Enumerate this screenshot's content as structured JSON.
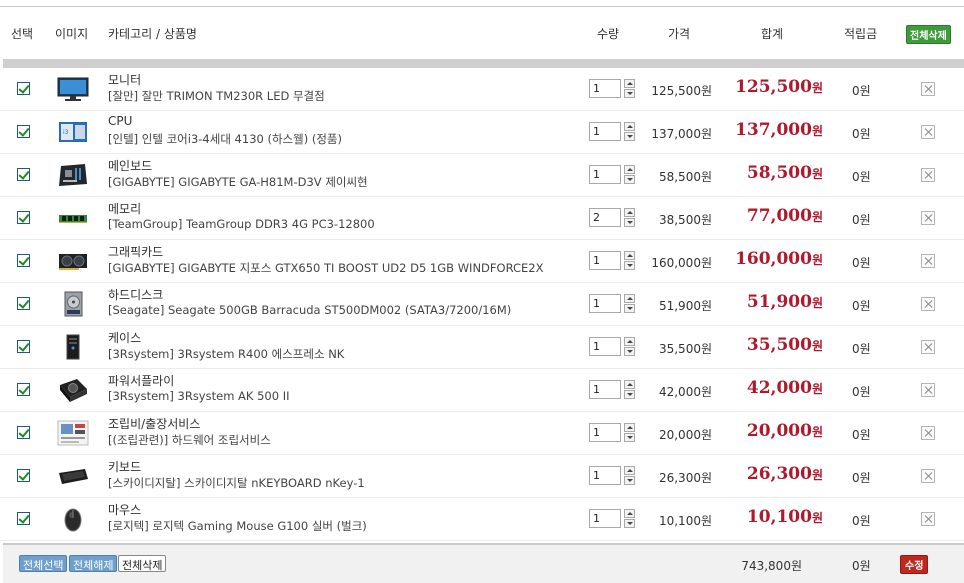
{
  "header": {
    "select": "선택",
    "image": "이미지",
    "name": "카테고리 / 상품명",
    "qty": "수량",
    "price": "가격",
    "total": "합계",
    "point": "적립금",
    "delete_all": "전체삭제"
  },
  "items": [
    {
      "icon": "monitor",
      "category": "모니터",
      "name": "[잘만] 잘만 TRIMON TM230R LED 무결점",
      "qty": "1",
      "price": "125,500원",
      "total": "125,500",
      "won": "원",
      "point": "0원"
    },
    {
      "icon": "cpu",
      "category": "CPU",
      "name": "[인텔] 인텔 코어i3-4세대 4130 (하스웰) (정품)",
      "qty": "1",
      "price": "137,000원",
      "total": "137,000",
      "won": "원",
      "point": "0원"
    },
    {
      "icon": "mainboard",
      "category": "메인보드",
      "name": "[GIGABYTE] GIGABYTE GA-H81M-D3V 제이씨현",
      "qty": "1",
      "price": "58,500원",
      "total": "58,500",
      "won": "원",
      "point": "0원"
    },
    {
      "icon": "memory",
      "category": "메모리",
      "name": "[TeamGroup] TeamGroup DDR3 4G PC3-12800",
      "qty": "2",
      "price": "38,500원",
      "total": "77,000",
      "won": "원",
      "point": "0원"
    },
    {
      "icon": "graphics-card",
      "category": "그래픽카드",
      "name": "[GIGABYTE] GIGABYTE 지포스 GTX650 TI BOOST UD2 D5 1GB WINDFORCE2X",
      "qty": "1",
      "price": "160,000원",
      "total": "160,000",
      "won": "원",
      "point": "0원"
    },
    {
      "icon": "hdd",
      "category": "하드디스크",
      "name": "[Seagate] Seagate 500GB Barracuda ST500DM002 (SATA3/7200/16M)",
      "qty": "1",
      "price": "51,900원",
      "total": "51,900",
      "won": "원",
      "point": "0원"
    },
    {
      "icon": "case",
      "category": "케이스",
      "name": "[3Rsystem] 3Rsystem R400 에스프레소 NK",
      "qty": "1",
      "price": "35,500원",
      "total": "35,500",
      "won": "원",
      "point": "0원"
    },
    {
      "icon": "psu",
      "category": "파워서플라이",
      "name": "[3Rsystem] 3Rsystem AK 500 II",
      "qty": "1",
      "price": "42,000원",
      "total": "42,000",
      "won": "원",
      "point": "0원"
    },
    {
      "icon": "assembly-service",
      "category": "조립비/출장서비스",
      "name": "[(조립관련)] 하드웨어 조립서비스",
      "qty": "1",
      "price": "20,000원",
      "total": "20,000",
      "won": "원",
      "point": "0원"
    },
    {
      "icon": "keyboard",
      "category": "키보드",
      "name": "[스카이디지탈] 스카이디지탈 nKEYBOARD nKey-1",
      "qty": "1",
      "price": "26,300원",
      "total": "26,300",
      "won": "원",
      "point": "0원"
    },
    {
      "icon": "mouse",
      "category": "마우스",
      "name": "[로지텍] 로지텍 Gaming Mouse G100 실버 (벌크)",
      "qty": "1",
      "price": "10,100원",
      "total": "10,100",
      "won": "원",
      "point": "0원"
    }
  ],
  "footer": {
    "select_all": "전체선택",
    "deselect_all": "전체해제",
    "delete_all": "전체삭제",
    "grand_total": "743,800원",
    "point": "0원",
    "edit": "수정"
  },
  "colors": {
    "total_red": "#b0182c",
    "green_button": "#3d9b3a",
    "blue_button": "#6f9fcb",
    "red_button": "#c0281f"
  }
}
